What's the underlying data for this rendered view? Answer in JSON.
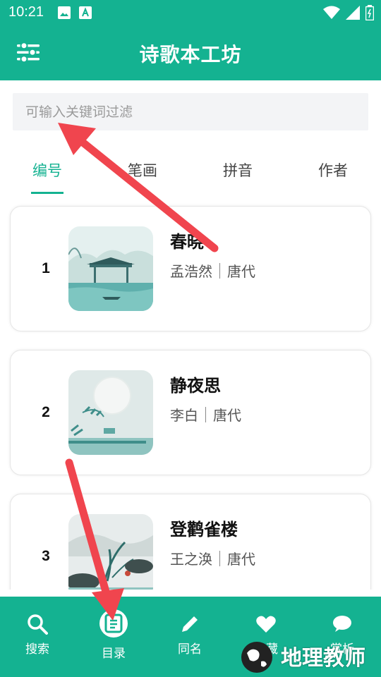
{
  "status_bar": {
    "time": "10:21"
  },
  "app_bar": {
    "title": "诗歌本工坊",
    "menu_icon": "sliders-icon"
  },
  "search": {
    "placeholder": "可输入关键词过滤"
  },
  "tabs": [
    {
      "label": "编号",
      "active": true
    },
    {
      "label": "笔画",
      "active": false
    },
    {
      "label": "拼音",
      "active": false
    },
    {
      "label": "作者",
      "active": false
    }
  ],
  "poems": [
    {
      "number": "1",
      "title": "春晓",
      "author": "孟浩然",
      "dynasty": "唐代"
    },
    {
      "number": "2",
      "title": "静夜思",
      "author": "李白",
      "dynasty": "唐代"
    },
    {
      "number": "3",
      "title": "登鹳雀楼",
      "author": "王之涣",
      "dynasty": "唐代"
    }
  ],
  "bottom_nav": [
    {
      "label": "搜索",
      "icon": "search-icon"
    },
    {
      "label": "目录",
      "icon": "catalog-icon",
      "active": true
    },
    {
      "label": "同名",
      "icon": "pencil-icon"
    },
    {
      "label": "收藏",
      "icon": "heart-icon"
    },
    {
      "label": "赏析",
      "icon": "chat-icon"
    }
  ],
  "watermark": {
    "text": "地理教师"
  },
  "colors": {
    "brand": "#14b291",
    "annotation_arrow": "#f0454e"
  }
}
